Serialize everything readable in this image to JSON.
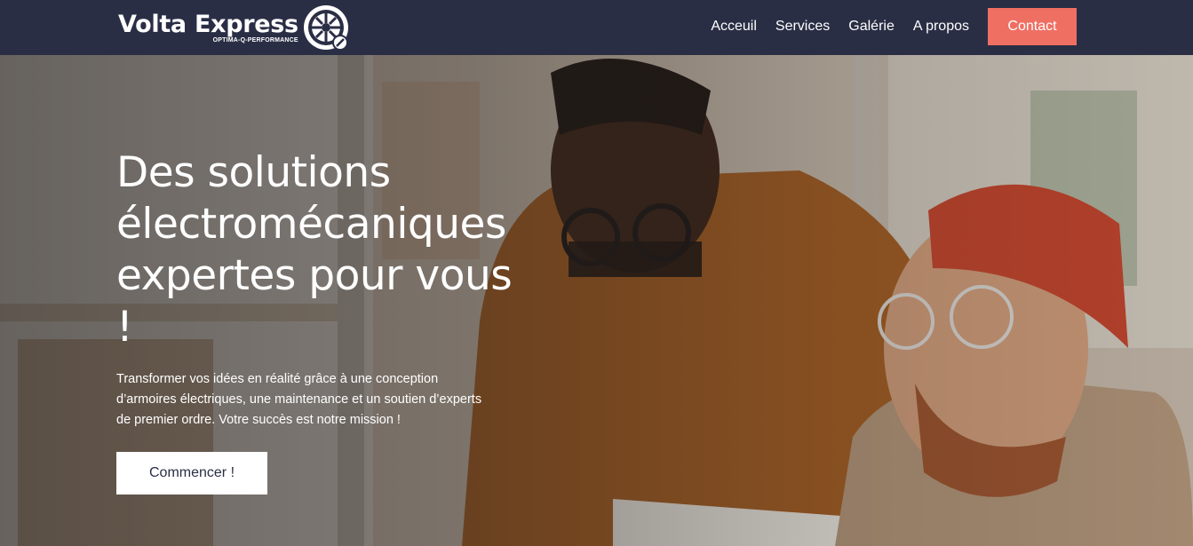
{
  "navbar": {
    "brand_name": "Volta Express",
    "brand_tagline": "OPTIMA-Q-PERFORMANCE",
    "links": [
      {
        "label": "Acceuil"
      },
      {
        "label": "Services"
      },
      {
        "label": "Galérie"
      },
      {
        "label": "A propos"
      }
    ],
    "contact_label": "Contact"
  },
  "hero": {
    "title": "Des solutions électromécaniques expertes pour vous !",
    "description": "Transformer vos idées en réalité grâce à une conception d’armoires électriques, une maintenance et un soutien d’experts de premier ordre. Votre succès est notre mission !",
    "cta_label": "Commencer !"
  },
  "colors": {
    "navbar_bg": "#2a2e45",
    "accent": "#ef6f63",
    "text": "#ffffff"
  },
  "icons": {
    "logo": "wheel-logo-icon"
  }
}
